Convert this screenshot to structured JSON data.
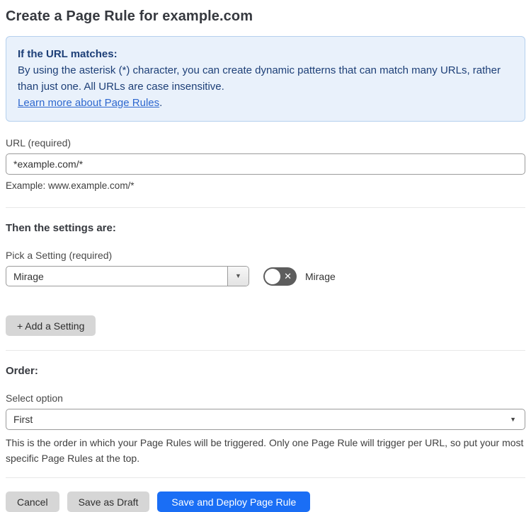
{
  "page": {
    "title": "Create a Page Rule for example.com"
  },
  "info_box": {
    "heading": "If the URL matches:",
    "body": "By using the asterisk (*) character, you can create dynamic patterns that can match many URLs, rather than just one. All URLs are case insensitive.",
    "link_label": "Learn more about Page Rules",
    "link_suffix": "."
  },
  "url_field": {
    "label": "URL (required)",
    "value": "*example.com/*",
    "helper": "Example: www.example.com/*"
  },
  "settings_section": {
    "heading": "Then the settings are:",
    "picker_label": "Pick a Setting (required)",
    "picker_value": "Mirage",
    "picker_arrow_icon": "▼",
    "toggle_label": "Mirage",
    "toggle_state": "off",
    "toggle_off_glyph": "✕",
    "add_setting_label": "+ Add a Setting"
  },
  "order_section": {
    "heading": "Order:",
    "select_label": "Select option",
    "select_value": "First",
    "select_arrow_icon": "▼",
    "helper": "This is the order in which your Page Rules will be triggered. Only one Page Rule will trigger per URL, so put your most specific Page Rules at the top."
  },
  "footer": {
    "cancel_label": "Cancel",
    "save_draft_label": "Save as Draft",
    "save_deploy_label": "Save and Deploy Page Rule"
  },
  "colors": {
    "info_bg": "#e9f1fb",
    "info_border": "#b5d0ee",
    "info_text": "#1d3f77",
    "link": "#2e68cf",
    "primary_button": "#1a6ef5",
    "toggle_off_bg": "#5d5d5d",
    "gray_button": "#d6d6d6",
    "divider": "#e8e8e8"
  }
}
